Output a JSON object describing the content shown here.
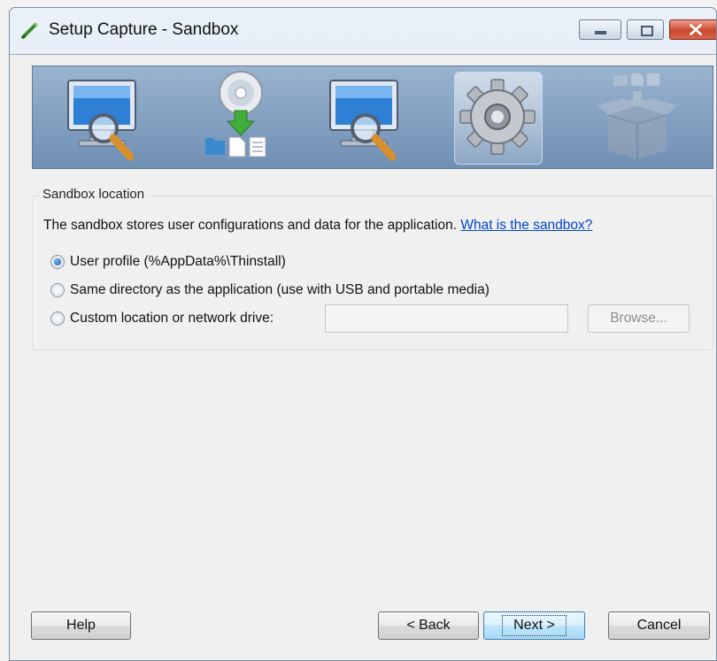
{
  "window": {
    "title": "Setup Capture - Sandbox",
    "icon": "app-icon",
    "controls": [
      "minimize-icon",
      "maximize-icon",
      "close-icon"
    ]
  },
  "wizard_steps": [
    {
      "name": "pre-scan",
      "icon": "monitor-magnifier-icon",
      "state": "done"
    },
    {
      "name": "install",
      "icon": "cd-download-icon",
      "state": "done"
    },
    {
      "name": "post-scan",
      "icon": "monitor-magnifier-icon",
      "state": "done"
    },
    {
      "name": "settings",
      "icon": "gear-icon",
      "state": "active"
    },
    {
      "name": "build",
      "icon": "box-icon",
      "state": "disabled"
    }
  ],
  "sandbox": {
    "legend": "Sandbox location",
    "description": "The sandbox stores user configurations and data for the application.",
    "link": "What is the sandbox?",
    "options": [
      {
        "label": "User profile (%AppData%\\Thinstall)",
        "checked": true
      },
      {
        "label": "Same directory as the application (use with USB and portable media)",
        "checked": false
      },
      {
        "label": "Custom location or network drive:",
        "checked": false
      }
    ],
    "custom_path": "",
    "browse_label": "Browse..."
  },
  "buttons": {
    "help": "Help",
    "back": "< Back",
    "next": "Next >",
    "cancel": "Cancel"
  }
}
